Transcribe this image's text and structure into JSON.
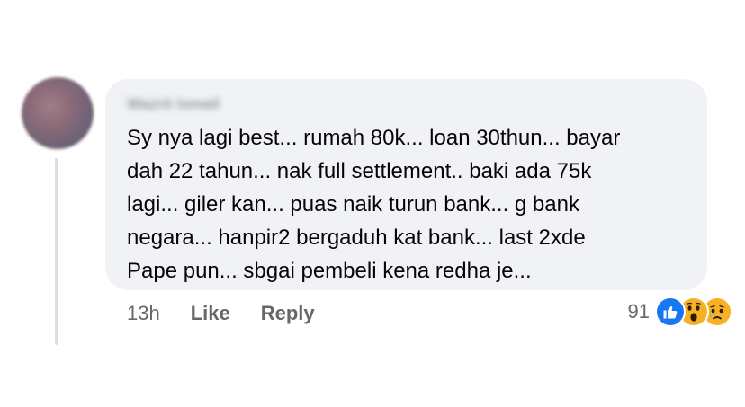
{
  "comment": {
    "author": "Wazrit Ismail",
    "text": "Sy nya lagi best... rumah 80k... loan 30thun... bayar\ndah 22 tahun... nak full settlement.. baki ada 75k\nlagi... giler kan... puas naik turun bank... g bank\nnegara... hanpir2 bergaduh kat bank... last 2xde\nPape pun... sbgai pembeli kena redha je..."
  },
  "actions": {
    "time": "13h",
    "like_label": "Like",
    "reply_label": "Reply"
  },
  "reactions": {
    "count": "91",
    "icons": [
      "like-icon",
      "wow-icon",
      "sad-icon"
    ]
  },
  "colors": {
    "bubble": "#f0f2f5",
    "text": "#050505",
    "secondary": "#65676b",
    "like_blue": "#1877f2",
    "emoji_yellow": "#f7b125"
  }
}
